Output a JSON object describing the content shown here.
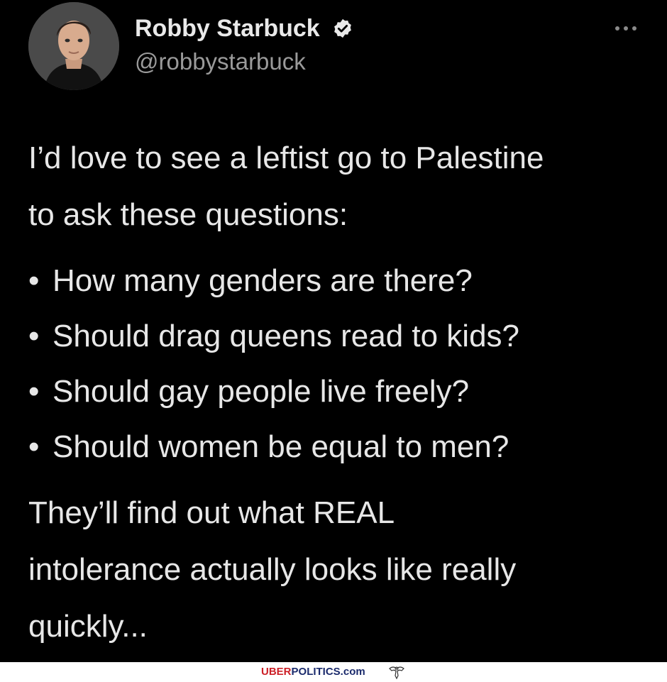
{
  "tweet": {
    "author": {
      "name": "Robby Starbuck",
      "handle": "@robbystarbuck",
      "verified": true,
      "avatar_icon": "profile-photo"
    },
    "menu_icon": "more-options-icon",
    "intro_line_1": "I’d love to see a leftist go to Palestine",
    "intro_line_2": "to ask these questions:",
    "bullet_char": "•",
    "questions": [
      "How many genders are there?",
      "Should drag queens read to kids?",
      "Should gay people live freely?",
      "Should women be equal to men?"
    ],
    "closing_line_1": "They’ll find out what REAL",
    "closing_line_2": "intolerance actually looks like really",
    "closing_line_3": "quickly..."
  },
  "watermark": {
    "part_red": "UBER",
    "part_blue": "POLITICS.com",
    "icon": "eagle-icon"
  },
  "colors": {
    "background": "#000000",
    "text": "#e7e7e7",
    "handle": "#9a9a9a",
    "watermark_red": "#cc1f26",
    "watermark_blue": "#1a2a6c"
  }
}
